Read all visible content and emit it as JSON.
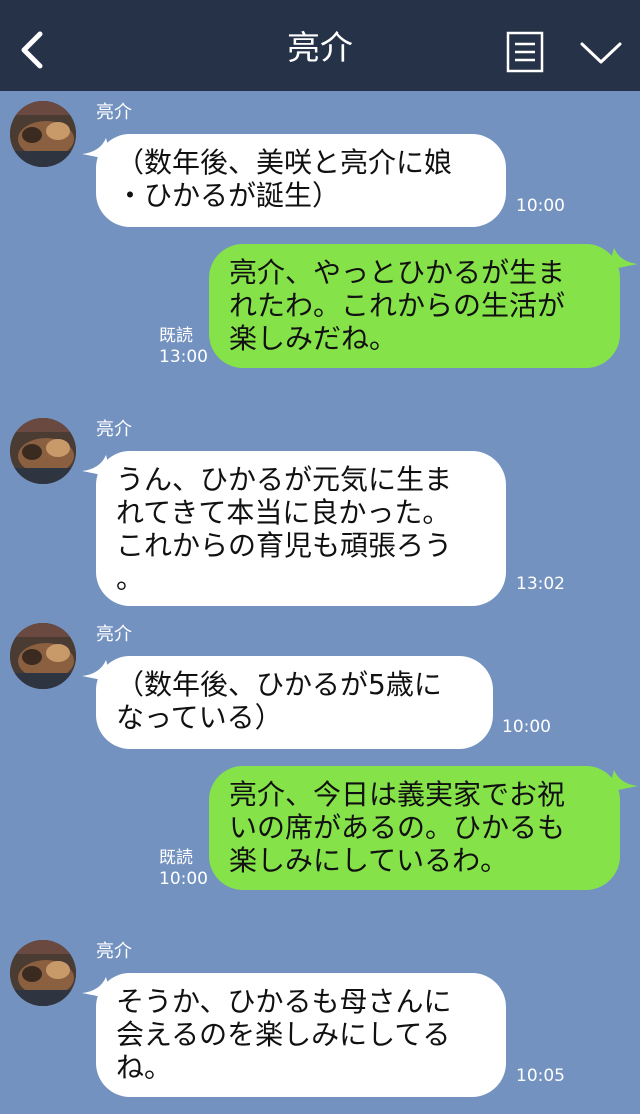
{
  "header": {
    "title": "亮介",
    "back_icon": "chevron-left-icon",
    "menu_icon": "document-menu-icon",
    "collapse_icon": "chevron-down-icon"
  },
  "messages": [
    {
      "side": "in",
      "sender": "亮介",
      "lines": [
        "（数年後、美咲と亮介に娘",
        "・ひかるが誕生）"
      ],
      "time": "10:00"
    },
    {
      "side": "out",
      "lines": [
        "亮介、やっとひかるが生ま",
        "れたわ。これからの生活が",
        "楽しみだね。"
      ],
      "read": "既読",
      "time": "13:00"
    },
    {
      "side": "in",
      "sender": "亮介",
      "lines": [
        "うん、ひかるが元気に生ま",
        "れてきて本当に良かった。",
        "これからの育児も頑張ろう",
        "。"
      ],
      "time": "13:02"
    },
    {
      "side": "in",
      "sender": "亮介",
      "lines": [
        "（数年後、ひかるが5歳に",
        "なっている）"
      ],
      "time": "10:00"
    },
    {
      "side": "out",
      "lines": [
        "亮介、今日は義実家でお祝",
        "いの席があるの。ひかるも",
        "楽しみにしているわ。"
      ],
      "read": "既読",
      "time": "10:00"
    },
    {
      "side": "in",
      "sender": "亮介",
      "lines": [
        "そうか、ひかるも母さんに",
        "会えるのを楽しみにしてる",
        "ね。"
      ],
      "time": "10:05"
    }
  ],
  "colors": {
    "background": "#7392c0",
    "header": "#263248",
    "bubble_in": "#ffffff",
    "bubble_out": "#85e249"
  }
}
